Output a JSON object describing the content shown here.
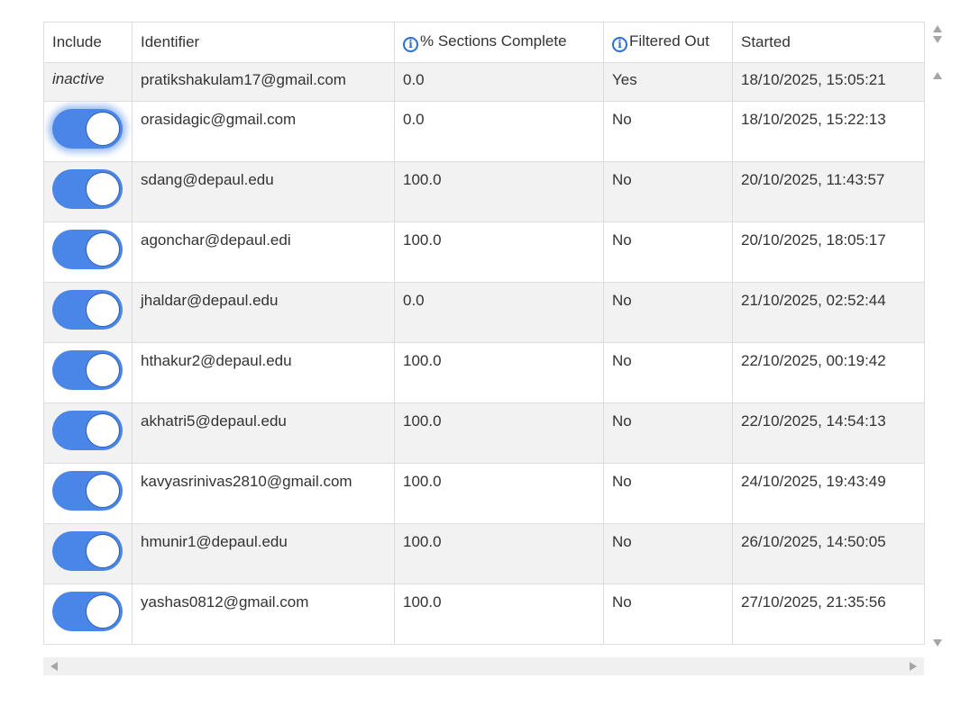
{
  "colors": {
    "toggle_on": "#4a86e8",
    "info_icon": "#2b6fd1",
    "zebra": "#f2f2f2",
    "border": "#dddddd"
  },
  "table": {
    "headers": {
      "include": "Include",
      "identifier": "Identifier",
      "sections": "% Sections Complete",
      "filtered": "Filtered Out",
      "started": "Started"
    },
    "info_icon_glyph": "i",
    "inactive_label": "inactive",
    "rows": [
      {
        "include": "inactive",
        "identifier": "pratikshakulam17@gmail.com",
        "sections": "0.0",
        "filtered": "Yes",
        "started": "18/10/2025, 15:05:21"
      },
      {
        "include": "on",
        "identifier": "orasidagic@gmail.com",
        "sections": "0.0",
        "filtered": "No",
        "started": "18/10/2025, 15:22:13"
      },
      {
        "include": "on",
        "identifier": "sdang@depaul.edu",
        "sections": "100.0",
        "filtered": "No",
        "started": "20/10/2025, 11:43:57"
      },
      {
        "include": "on",
        "identifier": "agonchar@depaul.edi",
        "sections": "100.0",
        "filtered": "No",
        "started": "20/10/2025, 18:05:17"
      },
      {
        "include": "on",
        "identifier": "jhaldar@depaul.edu",
        "sections": "0.0",
        "filtered": "No",
        "started": "21/10/2025, 02:52:44"
      },
      {
        "include": "on",
        "identifier": "hthakur2@depaul.edu",
        "sections": "100.0",
        "filtered": "No",
        "started": "22/10/2025, 00:19:42"
      },
      {
        "include": "on",
        "identifier": "akhatri5@depaul.edu",
        "sections": "100.0",
        "filtered": "No",
        "started": "22/10/2025, 14:54:13"
      },
      {
        "include": "on",
        "identifier": "kavyasrinivas2810@gmail.com",
        "sections": "100.0",
        "filtered": "No",
        "started": "24/10/2025, 19:43:49"
      },
      {
        "include": "on",
        "identifier": "hmunir1@depaul.edu",
        "sections": "100.0",
        "filtered": "No",
        "started": "26/10/2025, 14:50:05"
      },
      {
        "include": "on",
        "identifier": "yashas0812@gmail.com",
        "sections": "100.0",
        "filtered": "No",
        "started": "27/10/2025, 21:35:56"
      }
    ]
  }
}
